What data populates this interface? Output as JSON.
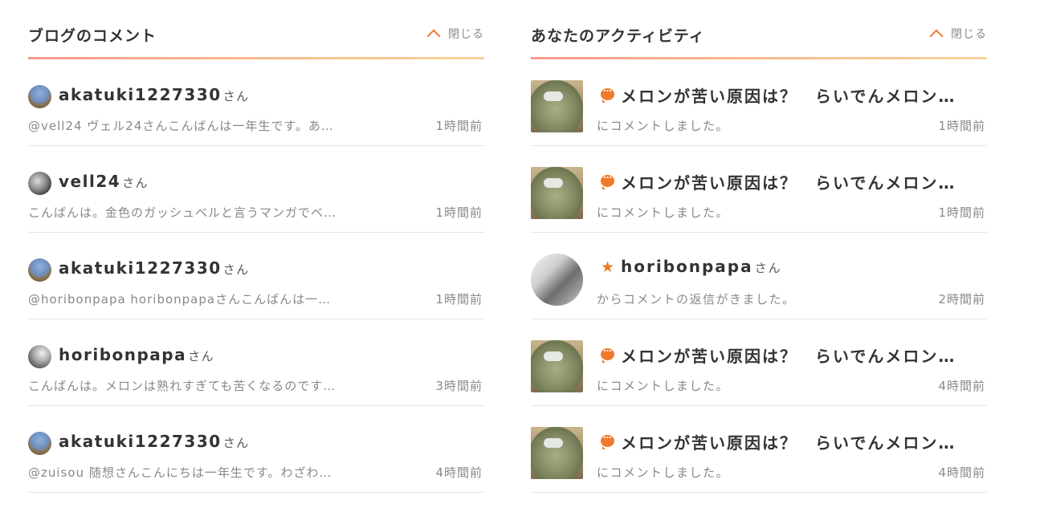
{
  "blog_comments": {
    "title": "ブログのコメント",
    "collapse_label": "閉じる",
    "items": [
      {
        "user": "akatuki1227330",
        "suffix": "さん",
        "text": "@vell24 ヴェル24さんこんばんは一年生です。あ…",
        "time": "1時間前"
      },
      {
        "user": "vell24",
        "suffix": "さん",
        "text": "こんばんは。金色のガッシュベルと言うマンガでベ…",
        "time": "1時間前"
      },
      {
        "user": "akatuki1227330",
        "suffix": "さん",
        "text": "@horibonpapa horibonpapaさんこんばんは一…",
        "time": "1時間前"
      },
      {
        "user": "horibonpapa",
        "suffix": "さん",
        "text": "こんばんは。メロンは熟れすぎても苦くなるのです…",
        "time": "3時間前"
      },
      {
        "user": "akatuki1227330",
        "suffix": "さん",
        "text": "@zuisou 随想さんこんにちは一年生です。わざわ…",
        "time": "4時間前"
      }
    ]
  },
  "activity": {
    "title": "あなたのアクティビティ",
    "collapse_label": "閉じる",
    "items": [
      {
        "icon": "comment-bubble-icon",
        "title": "メロンが苦い原因は？　らいでんメロン…",
        "title_suffix": "",
        "sub": "にコメントしました。",
        "time": "1時間前"
      },
      {
        "icon": "comment-bubble-icon",
        "title": "メロンが苦い原因は？　らいでんメロン…",
        "title_suffix": "",
        "sub": "にコメントしました。",
        "time": "1時間前"
      },
      {
        "icon": "star-icon",
        "title": "horibonpapa",
        "title_suffix": "さん",
        "sub": "からコメントの返信がきました。",
        "time": "2時間前"
      },
      {
        "icon": "comment-bubble-icon",
        "title": "メロンが苦い原因は？　らいでんメロン…",
        "title_suffix": "",
        "sub": "にコメントしました。",
        "time": "4時間前"
      },
      {
        "icon": "comment-bubble-icon",
        "title": "メロンが苦い原因は？　らいでんメロン…",
        "title_suffix": "",
        "sub": "にコメントしました。",
        "time": "4時間前"
      }
    ]
  },
  "colors": {
    "accent": "#f07a2c",
    "divider": "#e6e6e6",
    "muted_text": "#888888"
  }
}
